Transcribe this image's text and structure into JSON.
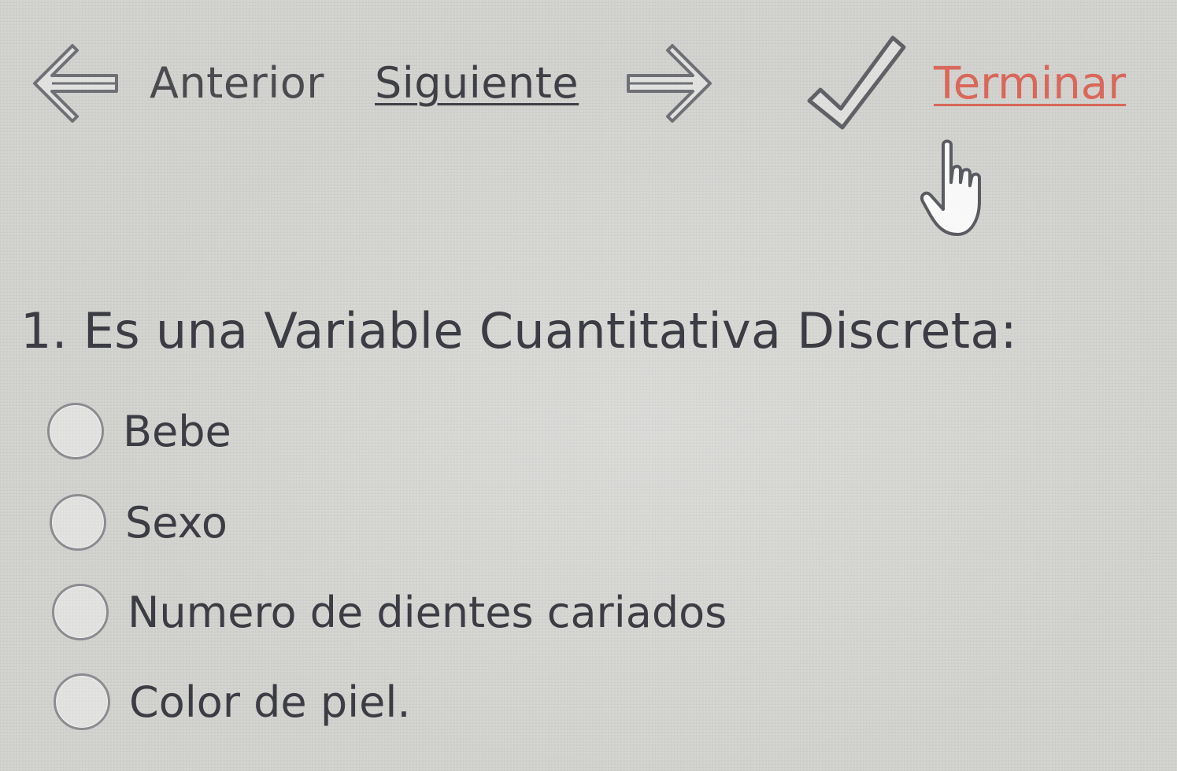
{
  "nav": {
    "previous_label": "Anterior",
    "next_label": "Siguiente",
    "finish_label": "Terminar",
    "finish_color": "#d9675a",
    "icons": {
      "previous": "left-arrow-icon",
      "next": "right-arrow-icon",
      "finish": "checkmark-icon",
      "cursor": "hand-pointer-icon"
    }
  },
  "question": {
    "text": "1. Es una Variable Cuantitativa Discreta:",
    "options": [
      {
        "label": "Bebe",
        "selected": false
      },
      {
        "label": "Sexo",
        "selected": false
      },
      {
        "label": "Numero de dientes cariados",
        "selected": false
      },
      {
        "label": "Color de piel.",
        "selected": false
      }
    ]
  }
}
